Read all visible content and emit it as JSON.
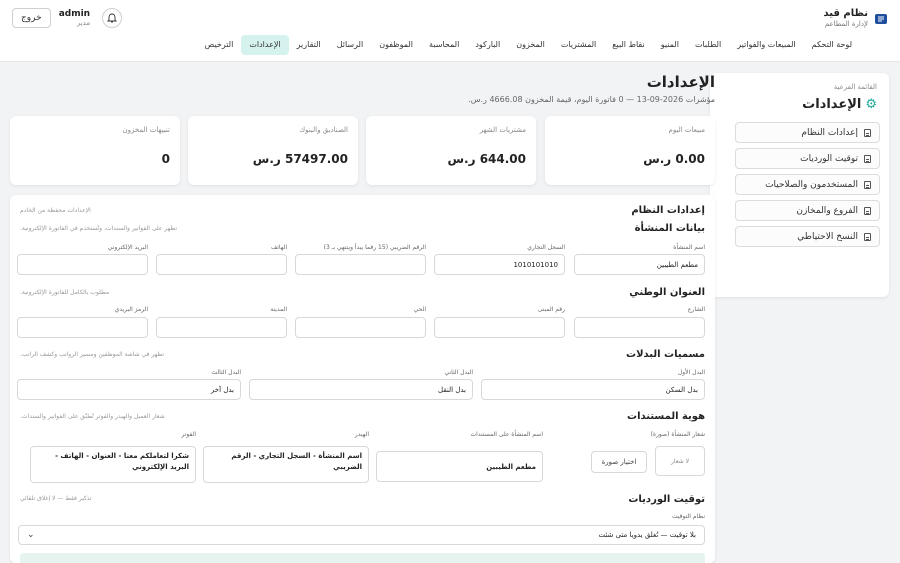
{
  "app": {
    "title": "نظام قيد",
    "subtitle": "لإدارة المطاعم",
    "logo_icon": "restaurant-logo-icon"
  },
  "user": {
    "name": "admin",
    "role": "مدير",
    "logout": "خروج"
  },
  "nav": [
    "لوحة التحكم",
    "المبيعات والفواتير",
    "الطلبات",
    "المنيو",
    "نقاط البيع",
    "المشتريات",
    "المخزون",
    "الباركود",
    "المحاسبة",
    "الموظفون",
    "الرسائل",
    "التقارير",
    "الإعدادات",
    "الترخيص"
  ],
  "nav_active_index": 12,
  "sidebar": {
    "caption": "القائمة الفرعية",
    "title": "الإعدادات",
    "items": [
      "إعدادات النظام",
      "توقيت الورديات",
      "المستخدمون والصلاحيات",
      "الفروع والمخازن",
      "النسخ الاحتياطي"
    ]
  },
  "page": {
    "title": "الإعدادات",
    "subtitle": "مؤشرات 2026-09-13 — 0 فاتورة اليوم، قيمة المخزون 4666.08 ر.س."
  },
  "stats": [
    {
      "label": "مبيعات اليوم",
      "value": "0.00 ر.س"
    },
    {
      "label": "مشتريات الشهر",
      "value": "644.00 ر.س"
    },
    {
      "label": "الصناديق والبنوك",
      "value": "57497.00 ر.س"
    },
    {
      "label": "تنبيهات المخزون",
      "value": "0"
    }
  ],
  "settings": {
    "title": "إعدادات النظام",
    "hint": "الإعدادات محفظة من الخادم",
    "org": {
      "title": "بيانات المنشأة",
      "hint": "تظهر على الفواتير والسندات، وتُستخدم في الفاتورة الإلكترونية.",
      "name_label": "اسم المنشأة",
      "name_value": "مطعم الطيبين",
      "cr_label": "السجل التجاري",
      "cr_value": "1010101010",
      "vat_label": "الرقم الضريبي (15 رقما يبدأ وينتهي بـ 3)",
      "vat_value": "",
      "phone_label": "الهاتف",
      "phone_value": "",
      "email_label": "البريد الإلكتروني",
      "email_value": ""
    },
    "address": {
      "title": "العنوان الوطني",
      "hint": "مطلوب بالكامل للفاتورة الإلكترونية.",
      "street_label": "الشارع",
      "building_label": "رقم المبنى",
      "district_label": "الحي",
      "city_label": "المدينة",
      "postal_label": "الرمز البريدي"
    },
    "allowances": {
      "title": "مسميات البدلات",
      "hint": "تظهر في شاشة الموظفين ومسير الرواتب وكشف الراتب.",
      "a1_label": "البدل الأول",
      "a1_value": "بدل السكن",
      "a2_label": "البدل الثاني",
      "a2_value": "بدل النقل",
      "a3_label": "البدل الثالث",
      "a3_value": "بدل آخر"
    },
    "identity": {
      "title": "هوية المستندات",
      "hint": "شعار العميل والهيدر والفوتر تُطبّق على الفواتير والسندات.",
      "logo_label": "شعار المنشأة (صورة)",
      "no_logo": "لا شعار",
      "choose_image": "اختيار صورة",
      "doc_name_label": "اسم المنشأة على المستندات",
      "doc_name_value": "مطعم الطيبين",
      "header_label": "الهيدر",
      "header_value": "اسم المنشأة - السجل التجاري - الرقم الضريبي",
      "footer_label": "الفوتر",
      "footer_value": "شكرا لتعاملكم معنا - العنوان - الهاتف - البريد الإلكتروني"
    },
    "shifts": {
      "title": "توقيت الورديات",
      "hint": "تذكير فقط — لا إغلاق تلقائي",
      "mode_label": "نظام التوقيت",
      "mode_value": "بلا توقيت — تُغلق يدويا متى شئت"
    }
  }
}
